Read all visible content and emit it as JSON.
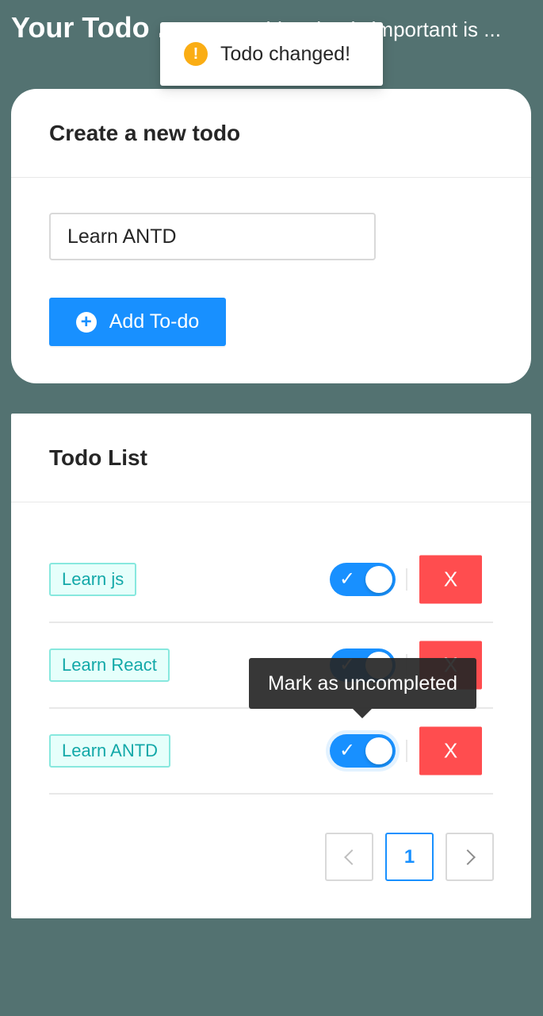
{
  "header": {
    "title": "Your Todo ...",
    "subtitle": "Everything that is important is ..."
  },
  "toast": {
    "icon": "warning-exclamation-icon",
    "message": "Todo changed!"
  },
  "create_card": {
    "title": "Create a new todo",
    "input_value": "Learn ANTD",
    "add_button_label": "Add To-do"
  },
  "list_card": {
    "title": "Todo List",
    "items": [
      {
        "label": "Learn js",
        "completed": true,
        "delete_label": "X"
      },
      {
        "label": "Learn React",
        "completed": true,
        "delete_label": "X"
      },
      {
        "label": "Learn ANTD",
        "completed": true,
        "delete_label": "X"
      }
    ],
    "tooltip": "Mark as uncompleted",
    "pagination": {
      "current_page": "1"
    }
  },
  "colors": {
    "background": "#537271",
    "primary": "#1890ff",
    "danger": "#ff4d4f",
    "tag_text": "#13a8a8",
    "warning": "#faad14"
  }
}
